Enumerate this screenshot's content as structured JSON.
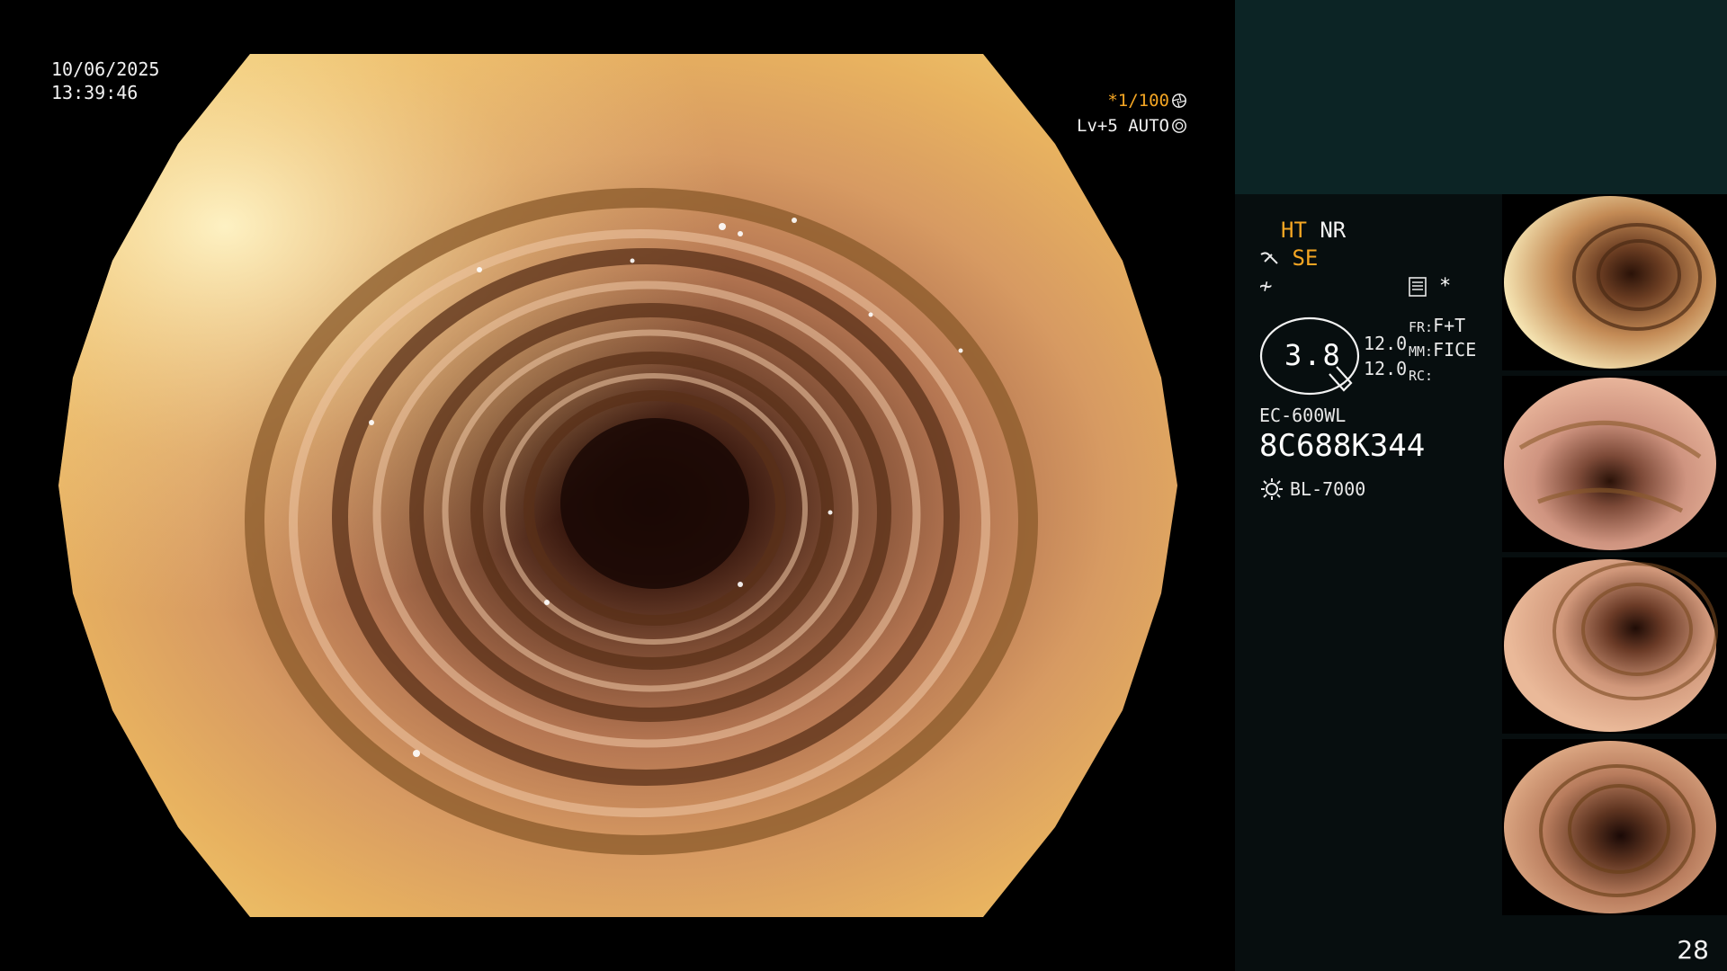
{
  "osd": {
    "date": "10/06/2025",
    "time": "13:39:46",
    "shutter": "*1/100",
    "shutter_icon": "aperture-icon",
    "exposure": "Lv+5 AUTO",
    "exposure_icon": "iris-icon"
  },
  "panel": {
    "ht": "HT",
    "nr": "NR",
    "se": "SE",
    "se_icon": "structure-enhance-icon",
    "f_symbol": "≁",
    "star": "*",
    "zoom_value": "3.8",
    "val_top": "12.0",
    "val_bottom": "12.0",
    "fr_label": "FR:",
    "fr_value": "F+T",
    "mm_label": "MM:",
    "mm_value": "FICE",
    "rc_label": "RC:",
    "scope_model": "EC-600WL",
    "serial": "8C688K344",
    "light_source": "BL-7000",
    "light_icon": "light-source-icon"
  },
  "page_number": "28",
  "colors": {
    "osd_yellow": "#f5a623",
    "panel_top_bg": "#0c2425",
    "panel_bg": "#070e0f"
  }
}
